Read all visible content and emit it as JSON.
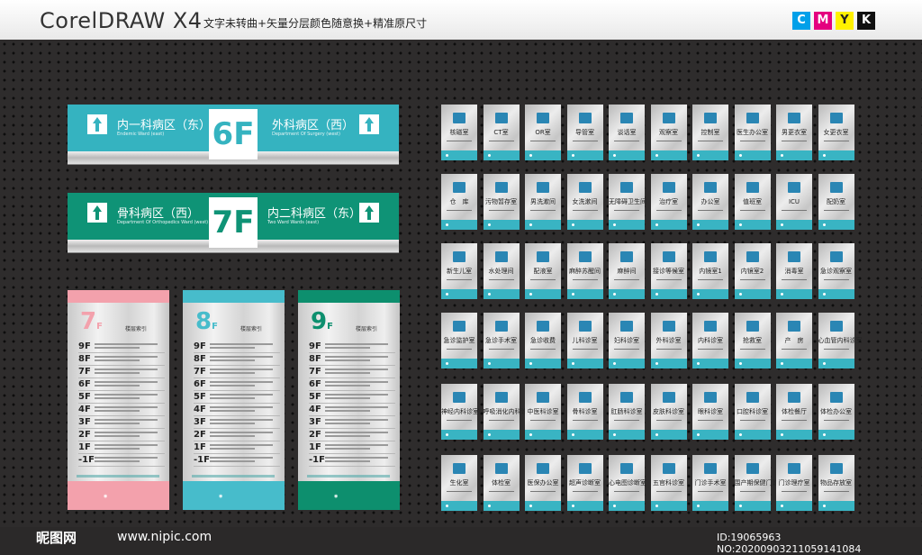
{
  "header": {
    "app_title": "CorelDRAW X4",
    "subtitle": "文字未转曲+矢量分层颜色随意换+精准原尺寸",
    "cmyk": [
      {
        "letter": "C",
        "color": "#00a0e9"
      },
      {
        "letter": "M",
        "color": "#e4007f"
      },
      {
        "letter": "Y",
        "color": "#fff100"
      },
      {
        "letter": "K",
        "color": "#111111"
      }
    ]
  },
  "signs": [
    {
      "floor": "6F",
      "left_name": "内一科病区（东）",
      "left_en": "Endemic Ward (east)",
      "right_name": "外科病区（西）",
      "right_en": "Department Of Surgery (west)",
      "color": "#35b3c0"
    },
    {
      "floor": "7F",
      "left_name": "骨科病区（西）",
      "left_en": "Department Of Orthopedics Ward (west)",
      "right_name": "内二科病区（东）",
      "right_en": "Two Ward Wards (east)",
      "color": "#0f9376"
    }
  ],
  "directories": [
    {
      "floor": "7",
      "floor_suffix": "F",
      "index_label": "楼层索引",
      "color": "#f3a1ac",
      "floors": [
        "9F",
        "8F",
        "7F",
        "6F",
        "5F",
        "4F",
        "3F",
        "2F",
        "1F",
        "-1F"
      ]
    },
    {
      "floor": "8",
      "floor_suffix": "F",
      "index_label": "楼层索引",
      "color": "#47bccb",
      "floors": [
        "9F",
        "8F",
        "7F",
        "6F",
        "5F",
        "4F",
        "3F",
        "2F",
        "1F",
        "-1F"
      ]
    },
    {
      "floor": "9",
      "floor_suffix": "F",
      "index_label": "楼层索引",
      "color": "#0d8f6e",
      "floors": [
        "9F",
        "8F",
        "7F",
        "6F",
        "5F",
        "4F",
        "3F",
        "2F",
        "1F",
        "-1F"
      ]
    }
  ],
  "door_signs": [
    "核磁室",
    "CT室",
    "OR室",
    "导管室",
    "谈话室",
    "观察室",
    "控制室",
    "医生办公室",
    "男更衣室",
    "女更衣室",
    "仓　库",
    "污物暂存室",
    "男洗漱间",
    "女洗漱间",
    "无障碍卫生间",
    "治疗室",
    "办公室",
    "值班室",
    "ICU",
    "配奶室",
    "新生儿室",
    "水处理间",
    "配液室",
    "麻醉苏醒间",
    "麻醉间",
    "接诊等候室",
    "内镜室1",
    "内镜室2",
    "消毒室",
    "急诊观察室",
    "急诊监护室",
    "急诊手术室",
    "急诊收费",
    "儿科诊室",
    "妇科诊室",
    "外科诊室",
    "内科诊室",
    "抢救室",
    "产　房",
    "心血管内科诊室",
    "神经内科诊室",
    "呼吸消化内科诊室",
    "中医科诊室",
    "骨科诊室",
    "肛肠科诊室",
    "皮肤科诊室",
    "眼科诊室",
    "口腔科诊室",
    "体检餐厅",
    "体检办公室",
    "生化室",
    "体检室",
    "医保办公室",
    "超声诊断室",
    "心电图诊断室",
    "五官科诊室",
    "门诊手术室",
    "围产期保健门诊",
    "门诊理疗室",
    "物品存放室"
  ],
  "footer": {
    "watermark": "昵图网",
    "site": "www.nipic.com",
    "id_text": "ID:19065963 NO:20200903211059141084"
  }
}
